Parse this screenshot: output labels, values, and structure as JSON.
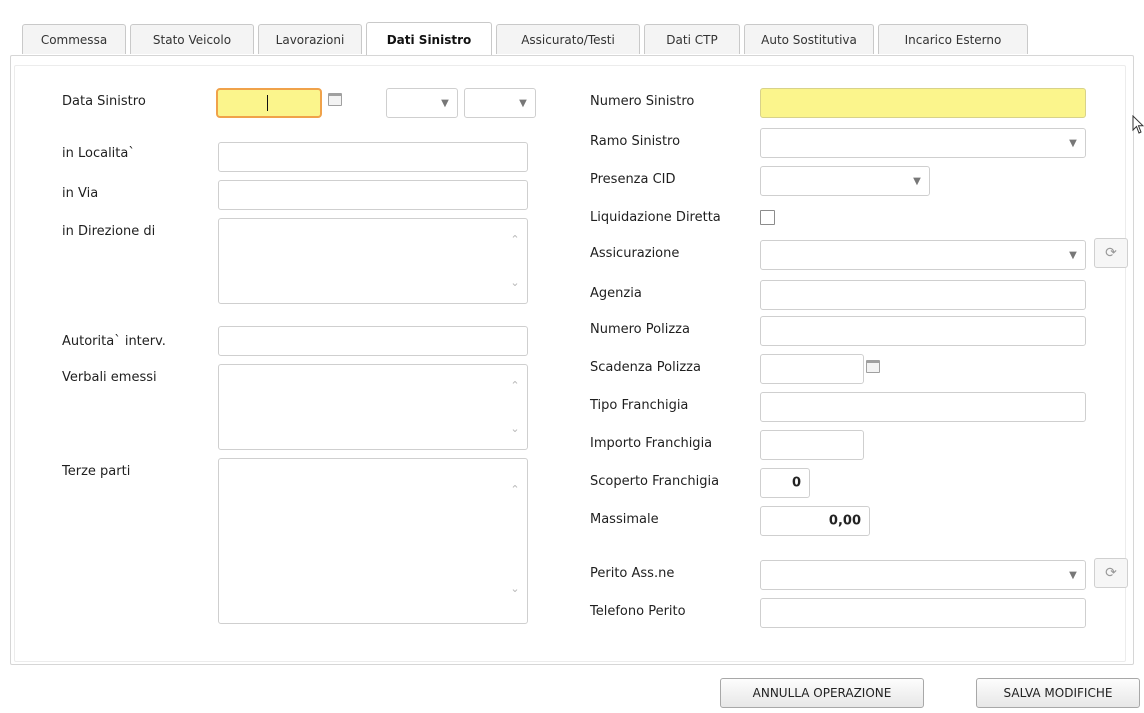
{
  "tabs": [
    {
      "label": "Commessa"
    },
    {
      "label": "Stato Veicolo"
    },
    {
      "label": "Lavorazioni"
    },
    {
      "label": "Dati Sinistro",
      "active": true
    },
    {
      "label": "Assicurato/Testi"
    },
    {
      "label": "Dati CTP"
    },
    {
      "label": "Auto Sostitutiva"
    },
    {
      "label": "Incarico Esterno"
    }
  ],
  "left": {
    "data_sinistro_label": "Data Sinistro",
    "in_localita_label": "in Localita`",
    "in_via_label": "in Via",
    "in_direzione_label": "in Direzione di",
    "autorita_label": "Autorita` interv.",
    "verbali_label": "Verbali emessi",
    "terze_parti_label": "Terze parti"
  },
  "right": {
    "numero_sinistro_label": "Numero Sinistro",
    "ramo_sinistro_label": "Ramo Sinistro",
    "presenza_cid_label": "Presenza CID",
    "liquidazione_label": "Liquidazione Diretta",
    "assicurazione_label": "Assicurazione",
    "agenzia_label": "Agenzia",
    "numero_polizza_label": "Numero Polizza",
    "scadenza_polizza_label": "Scadenza Polizza",
    "tipo_franchigia_label": "Tipo Franchigia",
    "importo_franchigia_label": "Importo Franchigia",
    "scoperto_franchigia_label": "Scoperto Franchigia",
    "scoperto_franchigia_value": "0",
    "massimale_label": "Massimale",
    "massimale_value": "0,00",
    "perito_label": "Perito Ass.ne",
    "telefono_perito_label": "Telefono Perito"
  },
  "buttons": {
    "annulla": "ANNULLA OPERAZIONE",
    "salva": "SALVA MODIFICHE"
  },
  "colors": {
    "required_bg": "#fbf58c",
    "focus_border": "#f0a24a"
  }
}
